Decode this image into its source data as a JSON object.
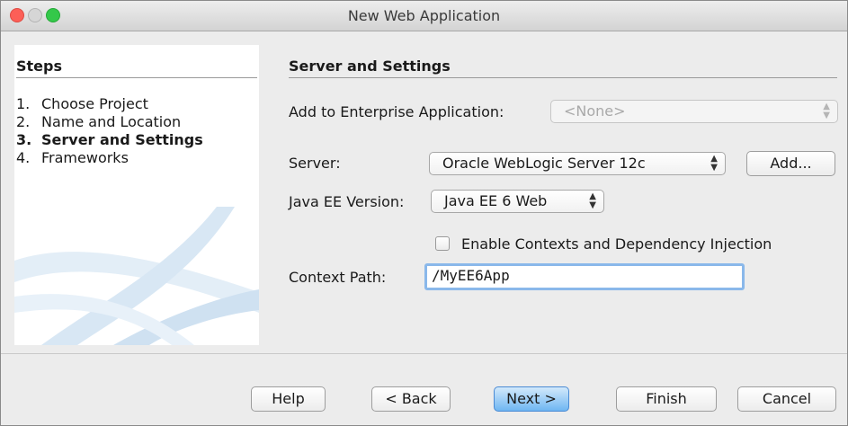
{
  "window": {
    "title": "New Web Application"
  },
  "steps": {
    "heading": "Steps",
    "items": [
      {
        "num": "1.",
        "label": "Choose Project"
      },
      {
        "num": "2.",
        "label": "Name and Location"
      },
      {
        "num": "3.",
        "label": "Server and Settings"
      },
      {
        "num": "4.",
        "label": "Frameworks"
      }
    ]
  },
  "panel": {
    "heading": "Server and Settings",
    "enterprise": {
      "label": "Add to Enterprise Application:",
      "value": "<None>"
    },
    "server": {
      "label": "Server:",
      "value": "Oracle WebLogic Server 12c",
      "add_label": "Add..."
    },
    "javaee": {
      "label": "Java EE Version:",
      "value": "Java EE 6 Web"
    },
    "cdi": {
      "label": "Enable Contexts and Dependency Injection",
      "checked": false
    },
    "context_path": {
      "label": "Context Path:",
      "value": "/MyEE6App"
    }
  },
  "footer": {
    "help": "Help",
    "back": "< Back",
    "next": "Next >",
    "finish": "Finish",
    "cancel": "Cancel"
  },
  "colors": {
    "default_button": "#6fb6f2",
    "focus_ring": "#8ab8ea"
  }
}
